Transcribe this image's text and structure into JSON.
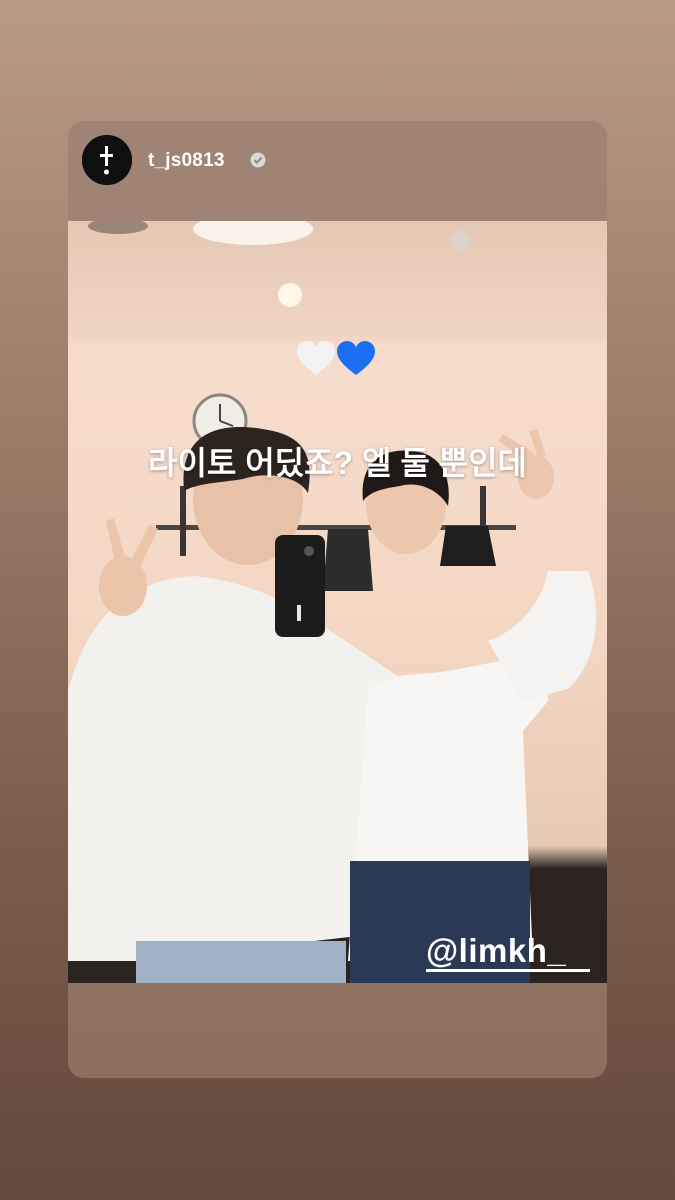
{
  "story": {
    "username": "t_js0813",
    "verified": true,
    "caption": "라이토 어딨죠? 엘 둘 뿐인데",
    "hearts": [
      "white-heart",
      "blue-heart"
    ],
    "mention": "@limkh_"
  },
  "colors": {
    "white_heart": "#f2f2f2",
    "blue_heart": "#1b6ff5"
  }
}
